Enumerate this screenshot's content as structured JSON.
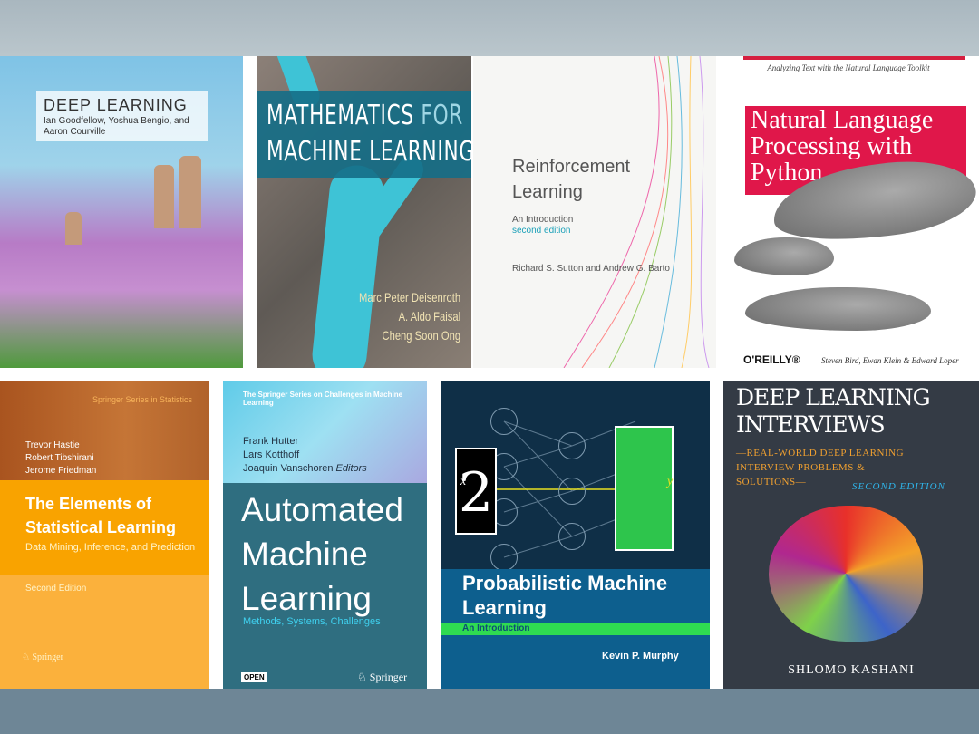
{
  "books": [
    {
      "title": "DEEP LEARNING",
      "authors": "Ian Goodfellow, Yoshua Bengio, and Aaron Courville"
    },
    {
      "title_part1": "MATHEMATICS",
      "title_for": "FOR",
      "title_part2": "MACHINE LEARNING",
      "authors": [
        "Marc Peter Deisenroth",
        "A. Aldo Faisal",
        "Cheng Soon Ong"
      ]
    },
    {
      "title": "Reinforcement Learning",
      "subtitle": "An Introduction",
      "edition": "second edition",
      "authors": "Richard S. Sutton and Andrew G. Barto"
    },
    {
      "series": "Analyzing Text with the Natural Language Toolkit",
      "title": "Natural Language Processing with Python",
      "publisher": "O'REILLY®",
      "authors": "Steven Bird, Ewan Klein & Edward Loper"
    },
    {
      "series": "Springer Series in Statistics",
      "authors": [
        "Trevor Hastie",
        "Robert Tibshirani",
        "Jerome Friedman"
      ],
      "title": "The Elements of Statistical Learning",
      "subtitle": "Data Mining, Inference, and Prediction",
      "edition": "Second Edition",
      "publisher": "Springer"
    },
    {
      "series": "The Springer Series on Challenges in Machine Learning",
      "authors": [
        "Frank Hutter",
        "Lars Kotthoff",
        "Joaquin Vanschoren"
      ],
      "editors_label": "Editors",
      "title": "Automated Machine Learning",
      "subtitle": "Methods, Systems, Challenges",
      "badge": "OPEN",
      "publisher": "Springer"
    },
    {
      "title": "Probabilistic Machine Learning",
      "subtitle": "An Introduction",
      "authors": "Kevin P. Murphy",
      "digit": "2",
      "x_label": "x",
      "y_label": "y"
    },
    {
      "title": "DEEP LEARNING INTERVIEWS",
      "subtitle": "—REAL-WORLD DEEP LEARNING INTERVIEW PROBLEMS & SOLUTIONS—",
      "edition": "SECOND EDITION",
      "authors": "SHLOMO KASHANI"
    }
  ]
}
